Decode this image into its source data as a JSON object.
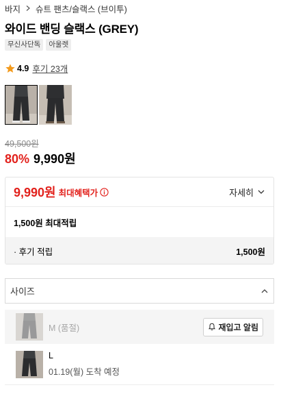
{
  "breadcrumb": {
    "level1": "바지",
    "level2": "슈트 팬츠/슬랙스 (브이투)"
  },
  "product": {
    "title": "와이드 밴딩 슬랙스 (GREY)",
    "tags": [
      "무신사단독",
      "아울렛"
    ],
    "rating": "4.9",
    "review_link": "후기 23개"
  },
  "gallery": {
    "thumbnail_count": 2,
    "selected_index": 0
  },
  "price": {
    "original": "49,500원",
    "discount_rate": "80%",
    "sale": "9,990원"
  },
  "benefit": {
    "max_price": "9,990원",
    "max_label": "최대혜택가",
    "detail_label": "자세히",
    "points_label": "1,500원 최대적립",
    "sub_label": "· 후기 적립",
    "sub_value": "1,500원"
  },
  "size_selector": {
    "placeholder": "사이즈",
    "options": [
      {
        "label": "M (품절)",
        "sub": "",
        "status": "soldout",
        "action_label": "재입고 알림"
      },
      {
        "label": "L",
        "sub": "01.19(월) 도착 예정",
        "status": "available"
      }
    ]
  },
  "colors": {
    "accent_red": "#e2211c",
    "star": "#f39a1c"
  }
}
